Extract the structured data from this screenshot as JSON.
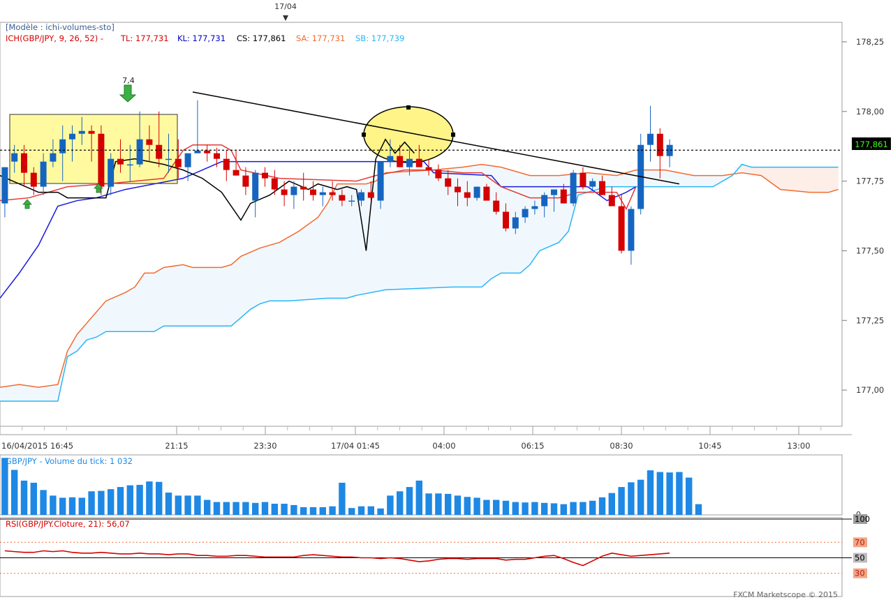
{
  "top_marker": {
    "label": "17/04"
  },
  "header": {
    "model": "[Modèle : ichi-volumes-sto]",
    "indicator": "ICH(GBP/JPY, 9, 26, 52) -",
    "tl": "TL: 177,731",
    "kl": "KL: 177,731",
    "cs": "CS: 177,861",
    "sa": "SA: 177,731",
    "sb": "SB: 177,739"
  },
  "colors": {
    "up": "#1565c0",
    "down": "#d50000",
    "tenkan": "#e53935",
    "kijun": "#1a1ae0",
    "chikou": "#000000",
    "senkou_a": "#f26a2e",
    "senkou_b": "#29b6f6",
    "kumo": "#f1f8fd",
    "volume": "#1e88e5",
    "rsi": "#d50000",
    "highlight": "#fffaa0"
  },
  "price_labels": {
    "current": "177,861",
    "arrow_signal": "7,4"
  },
  "volume_panel": {
    "title": "GBP/JPY - Volume du tick: 1 032",
    "zero_label": "0"
  },
  "rsi_panel": {
    "title": "RSI(GBP/JPY.Cloture, 21): 56,07"
  },
  "footer": {
    "brand": "FXCM Marketscope © 2015"
  },
  "chart_data": {
    "type": "candlestick",
    "price_axis": {
      "min": 176.87,
      "max": 178.32,
      "ticks": [
        178.25,
        178.0,
        177.75,
        177.5,
        177.25,
        177.0
      ],
      "tick_labels": [
        "178,25",
        "178,00",
        "177,75",
        "177,50",
        "177,25",
        "177,00"
      ]
    },
    "time_labels": [
      "16/04/2015 16:45",
      "21:15",
      "23:30",
      "17/04 01:45",
      "04:00",
      "06:15",
      "08:30",
      "10:45",
      "13:00"
    ],
    "candles": [
      [
        177.67,
        177.8,
        177.62,
        177.8
      ],
      [
        177.82,
        177.88,
        177.78,
        177.85
      ],
      [
        177.85,
        177.88,
        177.73,
        177.78
      ],
      [
        177.78,
        177.8,
        177.7,
        177.73
      ],
      [
        177.73,
        177.85,
        177.7,
        177.82
      ],
      [
        177.82,
        177.9,
        177.8,
        177.85
      ],
      [
        177.85,
        177.95,
        177.75,
        177.9
      ],
      [
        177.9,
        177.95,
        177.82,
        177.92
      ],
      [
        177.92,
        177.98,
        177.88,
        177.93
      ],
      [
        177.93,
        177.95,
        177.82,
        177.92
      ],
      [
        177.92,
        177.95,
        177.7,
        177.73
      ],
      [
        177.73,
        177.85,
        177.7,
        177.83
      ],
      [
        177.83,
        177.9,
        177.78,
        177.81
      ],
      [
        177.81,
        177.88,
        177.75,
        177.81
      ],
      [
        177.81,
        178.0,
        177.8,
        177.9
      ],
      [
        177.9,
        177.95,
        177.82,
        177.88
      ],
      [
        177.88,
        178.0,
        177.8,
        177.83
      ],
      [
        177.83,
        177.92,
        177.78,
        177.83
      ],
      [
        177.83,
        177.9,
        177.76,
        177.8
      ],
      [
        177.8,
        177.85,
        177.75,
        177.85
      ],
      [
        177.85,
        178.04,
        177.85,
        177.86
      ],
      [
        177.86,
        177.88,
        177.82,
        177.85
      ],
      [
        177.85,
        177.87,
        177.8,
        177.83
      ],
      [
        177.83,
        177.86,
        177.75,
        177.79
      ],
      [
        177.79,
        177.86,
        177.77,
        177.77
      ],
      [
        177.77,
        177.8,
        177.7,
        177.73
      ],
      [
        177.68,
        177.79,
        177.62,
        177.78
      ],
      [
        177.78,
        177.8,
        177.73,
        177.76
      ],
      [
        177.76,
        177.79,
        177.7,
        177.72
      ],
      [
        177.72,
        177.75,
        177.66,
        177.7
      ],
      [
        177.7,
        177.75,
        177.65,
        177.73
      ],
      [
        177.73,
        177.78,
        177.68,
        177.72
      ],
      [
        177.72,
        177.75,
        177.68,
        177.7
      ],
      [
        177.7,
        177.73,
        177.66,
        177.71
      ],
      [
        177.71,
        177.75,
        177.68,
        177.7
      ],
      [
        177.7,
        177.72,
        177.66,
        177.68
      ],
      [
        177.68,
        177.7,
        177.66,
        177.68
      ],
      [
        177.68,
        177.72,
        177.66,
        177.71
      ],
      [
        177.71,
        177.75,
        177.68,
        177.69
      ],
      [
        177.68,
        177.8,
        177.65,
        177.82
      ],
      [
        177.82,
        177.9,
        177.8,
        177.84
      ],
      [
        177.84,
        177.88,
        177.8,
        177.8
      ],
      [
        177.8,
        177.87,
        177.77,
        177.83
      ],
      [
        177.83,
        177.88,
        177.8,
        177.8
      ],
      [
        177.8,
        177.83,
        177.77,
        177.79
      ],
      [
        177.79,
        177.81,
        177.75,
        177.76
      ],
      [
        177.76,
        177.79,
        177.7,
        177.73
      ],
      [
        177.73,
        177.76,
        177.66,
        177.71
      ],
      [
        177.71,
        177.75,
        177.66,
        177.69
      ],
      [
        177.69,
        177.73,
        177.68,
        177.73
      ],
      [
        177.73,
        177.74,
        177.68,
        177.68
      ],
      [
        177.68,
        177.71,
        177.63,
        177.64
      ],
      [
        177.64,
        177.67,
        177.57,
        177.58
      ],
      [
        177.58,
        177.64,
        177.56,
        177.62
      ],
      [
        177.62,
        177.66,
        177.6,
        177.65
      ],
      [
        177.65,
        177.68,
        177.63,
        177.66
      ],
      [
        177.66,
        177.71,
        177.62,
        177.7
      ],
      [
        177.7,
        177.72,
        177.64,
        177.72
      ],
      [
        177.72,
        177.74,
        177.68,
        177.67
      ],
      [
        177.67,
        177.79,
        177.66,
        177.78
      ],
      [
        177.78,
        177.8,
        177.72,
        177.73
      ],
      [
        177.73,
        177.76,
        177.72,
        177.75
      ],
      [
        177.75,
        177.77,
        177.72,
        177.7
      ],
      [
        177.7,
        177.73,
        177.66,
        177.66
      ],
      [
        177.66,
        177.7,
        177.49,
        177.5
      ],
      [
        177.5,
        177.66,
        177.45,
        177.65
      ],
      [
        177.65,
        177.92,
        177.63,
        177.88
      ],
      [
        177.88,
        178.02,
        177.82,
        177.92
      ],
      [
        177.92,
        177.94,
        177.76,
        177.84
      ],
      [
        177.84,
        177.9,
        177.8,
        177.88
      ]
    ],
    "tenkan": [
      [
        0,
        177.68
      ],
      [
        3,
        177.69
      ],
      [
        7,
        177.73
      ],
      [
        11,
        177.74
      ],
      [
        14,
        177.75
      ],
      [
        17,
        177.76
      ],
      [
        19,
        177.86
      ],
      [
        20,
        177.88
      ],
      [
        23,
        177.88
      ],
      [
        24,
        177.86
      ],
      [
        25,
        177.79
      ],
      [
        29,
        177.76
      ],
      [
        37,
        177.75
      ],
      [
        39,
        177.77
      ],
      [
        42,
        177.79
      ],
      [
        45,
        177.79
      ],
      [
        48,
        177.78
      ],
      [
        50,
        177.78
      ],
      [
        52,
        177.73
      ],
      [
        55,
        177.69
      ],
      [
        58,
        177.69
      ],
      [
        60,
        177.71
      ],
      [
        61,
        177.71
      ],
      [
        64,
        177.71
      ],
      [
        65,
        177.65
      ],
      [
        66,
        177.73
      ]
    ],
    "kijun": [
      [
        0,
        177.33
      ],
      [
        2,
        177.42
      ],
      [
        4,
        177.52
      ],
      [
        6,
        177.66
      ],
      [
        8,
        177.68
      ],
      [
        10,
        177.69
      ],
      [
        11,
        177.7
      ],
      [
        13,
        177.72
      ],
      [
        19,
        177.76
      ],
      [
        21,
        177.79
      ],
      [
        23,
        177.82
      ],
      [
        44,
        177.82
      ],
      [
        45,
        177.78
      ],
      [
        51,
        177.77
      ],
      [
        52,
        177.73
      ],
      [
        61,
        177.73
      ],
      [
        63,
        177.68
      ],
      [
        65,
        177.71
      ],
      [
        66,
        177.73
      ]
    ],
    "chikou": [
      [
        0,
        177.77
      ],
      [
        2,
        177.74
      ],
      [
        4,
        177.71
      ],
      [
        6,
        177.71
      ],
      [
        7,
        177.69
      ],
      [
        9,
        177.69
      ],
      [
        11,
        177.69
      ],
      [
        12,
        177.82
      ],
      [
        14,
        177.83
      ],
      [
        17,
        177.81
      ],
      [
        19,
        177.79
      ],
      [
        21,
        177.76
      ],
      [
        23,
        177.71
      ],
      [
        24,
        177.66
      ],
      [
        25,
        177.61
      ],
      [
        26,
        177.67
      ],
      [
        28,
        177.7
      ],
      [
        30,
        177.75
      ],
      [
        32,
        177.72
      ],
      [
        33,
        177.74
      ],
      [
        35,
        177.72
      ],
      [
        36,
        177.73
      ],
      [
        37,
        177.72
      ],
      [
        38,
        177.5
      ],
      [
        39,
        177.83
      ],
      [
        40,
        177.9
      ],
      [
        41,
        177.85
      ],
      [
        42,
        177.89
      ],
      [
        43,
        177.85
      ]
    ],
    "senkou_a": [
      [
        0,
        177.01
      ],
      [
        2,
        177.02
      ],
      [
        4,
        177.01
      ],
      [
        6,
        177.02
      ],
      [
        7,
        177.14
      ],
      [
        8,
        177.2
      ],
      [
        10,
        177.28
      ],
      [
        11,
        177.32
      ],
      [
        13,
        177.35
      ],
      [
        14,
        177.37
      ],
      [
        15,
        177.42
      ],
      [
        16,
        177.42
      ],
      [
        17,
        177.44
      ],
      [
        19,
        177.45
      ],
      [
        20,
        177.44
      ],
      [
        21,
        177.44
      ],
      [
        23,
        177.44
      ],
      [
        24,
        177.45
      ],
      [
        25,
        177.48
      ],
      [
        27,
        177.51
      ],
      [
        29,
        177.53
      ],
      [
        31,
        177.57
      ],
      [
        33,
        177.62
      ],
      [
        34,
        177.67
      ],
      [
        35,
        177.74
      ],
      [
        37,
        177.74
      ],
      [
        38,
        177.74
      ],
      [
        39,
        177.75
      ],
      [
        40,
        177.78
      ],
      [
        45,
        177.79
      ],
      [
        48,
        177.8
      ],
      [
        50,
        177.81
      ],
      [
        52,
        177.8
      ],
      [
        55,
        177.77
      ],
      [
        58,
        177.77
      ],
      [
        61,
        177.78
      ],
      [
        64,
        177.77
      ],
      [
        65,
        177.78
      ],
      [
        66,
        177.79
      ],
      [
        69,
        177.79
      ],
      [
        72,
        177.77
      ],
      [
        75,
        177.77
      ],
      [
        77,
        177.78
      ],
      [
        79,
        177.77
      ],
      [
        81,
        177.72
      ],
      [
        84,
        177.71
      ],
      [
        86,
        177.71
      ],
      [
        87,
        177.72
      ]
    ],
    "senkou_b": [
      [
        0,
        176.96
      ],
      [
        6,
        176.96
      ],
      [
        7,
        177.12
      ],
      [
        8,
        177.14
      ],
      [
        9,
        177.18
      ],
      [
        10,
        177.19
      ],
      [
        11,
        177.21
      ],
      [
        16,
        177.21
      ],
      [
        17,
        177.23
      ],
      [
        24,
        177.23
      ],
      [
        25,
        177.26
      ],
      [
        26,
        177.29
      ],
      [
        27,
        177.31
      ],
      [
        28,
        177.32
      ],
      [
        30,
        177.32
      ],
      [
        34,
        177.33
      ],
      [
        36,
        177.33
      ],
      [
        37,
        177.34
      ],
      [
        40,
        177.36
      ],
      [
        47,
        177.37
      ],
      [
        50,
        177.37
      ],
      [
        51,
        177.4
      ],
      [
        52,
        177.42
      ],
      [
        54,
        177.42
      ],
      [
        55,
        177.45
      ],
      [
        56,
        177.5
      ],
      [
        58,
        177.53
      ],
      [
        59,
        177.57
      ],
      [
        60,
        177.7
      ],
      [
        62,
        177.72
      ],
      [
        63,
        177.73
      ],
      [
        66,
        177.73
      ],
      [
        74,
        177.73
      ],
      [
        76,
        177.77
      ],
      [
        77,
        177.81
      ],
      [
        78,
        177.8
      ],
      [
        87,
        177.8
      ]
    ],
    "trendline": {
      "start": {
        "index": 20,
        "price": 178.07
      },
      "end": {
        "index": 70.5,
        "price": 177.74
      }
    },
    "volume": {
      "max": 1400,
      "values": [
        1330,
        1050,
        800,
        750,
        580,
        450,
        400,
        410,
        400,
        550,
        560,
        600,
        650,
        690,
        700,
        780,
        770,
        520,
        450,
        450,
        450,
        350,
        300,
        300,
        300,
        300,
        280,
        300,
        260,
        260,
        230,
        180,
        180,
        180,
        200,
        750,
        160,
        200,
        200,
        150,
        450,
        550,
        650,
        800,
        500,
        500,
        490,
        450,
        420,
        400,
        350,
        350,
        330,
        300,
        290,
        300,
        280,
        270,
        250,
        300,
        300,
        330,
        410,
        510,
        650,
        760,
        820,
        1040,
        1000,
        990,
        1000,
        870,
        250
      ]
    },
    "rsi": {
      "min": 0,
      "max": 100,
      "ticks": [
        100,
        70,
        50,
        30
      ],
      "values": [
        59,
        58,
        57,
        57,
        59,
        58,
        59,
        57,
        56,
        56,
        57,
        56,
        55,
        55,
        56,
        55,
        55,
        54,
        55,
        55,
        53,
        53,
        52,
        52,
        53,
        53,
        52,
        51,
        51,
        51,
        51,
        53,
        54,
        53,
        52,
        51,
        51,
        50,
        50,
        49,
        50,
        49,
        47,
        45,
        46,
        48,
        49,
        49,
        48,
        49,
        49,
        49,
        47,
        48,
        48,
        50,
        52,
        53,
        49,
        44,
        40,
        46,
        52,
        56,
        54,
        52,
        53,
        54,
        55,
        56
      ]
    }
  }
}
